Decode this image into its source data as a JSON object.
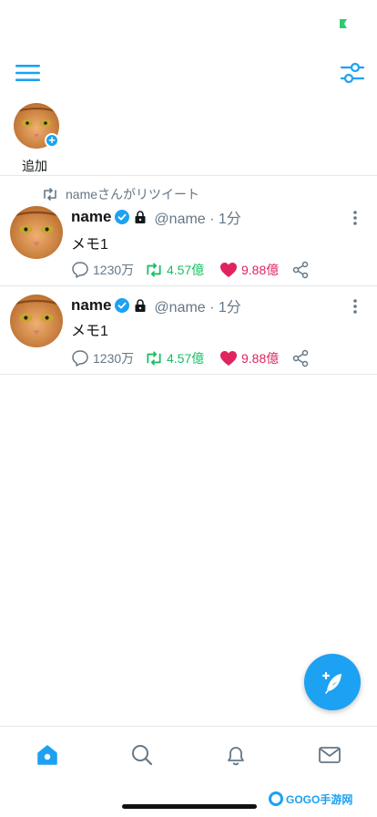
{
  "status_bar": {
    "indicator_color": "#2ecc71"
  },
  "header": {
    "menu_icon": "hamburger-menu-icon",
    "filter_icon": "filter-sliders-icon"
  },
  "story": {
    "add_label": "追加"
  },
  "tweets": [
    {
      "retweeted_by": "nameさんがリツイート",
      "name": "name",
      "handle": "@name · 1分",
      "text": "メモ1",
      "reply_count": "1230万",
      "retweet_count": "4.57億",
      "like_count": "9.88億"
    },
    {
      "name": "name",
      "handle": "@name · 1分",
      "text": "メモ1",
      "reply_count": "1230万",
      "retweet_count": "4.57億",
      "like_count": "9.88億"
    }
  ],
  "fab": {
    "icon": "compose-feather-icon"
  },
  "bottom_nav": {
    "items": [
      {
        "icon": "home-icon",
        "active": true
      },
      {
        "icon": "search-icon"
      },
      {
        "icon": "bell-icon"
      },
      {
        "icon": "mail-icon"
      }
    ]
  },
  "watermark": {
    "text": "GOGO手游网"
  },
  "colors": {
    "accent": "#1da1f2",
    "retweet": "#17bf63",
    "like": "#e0245e",
    "secondary_text": "#657786"
  }
}
